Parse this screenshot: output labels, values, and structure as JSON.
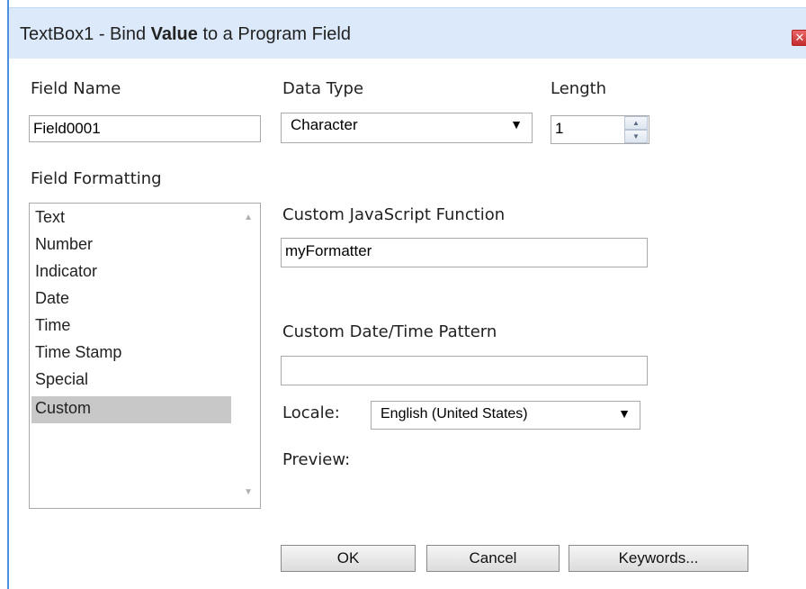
{
  "dialog": {
    "title_prefix": "TextBox1 - Bind ",
    "title_bold": "Value",
    "title_suffix": " to a Program Field",
    "close_glyph": "✕"
  },
  "field_name": {
    "label": "Field Name",
    "value": "Field0001"
  },
  "data_type": {
    "label": "Data Type",
    "value": "Character"
  },
  "length": {
    "label": "Length",
    "value": "1"
  },
  "field_formatting": {
    "label": "Field Formatting",
    "items": [
      "Text",
      "Number",
      "Indicator",
      "Date",
      "Time",
      "Time Stamp",
      "Special",
      "Custom"
    ],
    "selected": "Custom"
  },
  "custom_js": {
    "label": "Custom JavaScript Function",
    "value": "myFormatter"
  },
  "custom_pattern": {
    "label": "Custom Date/Time Pattern",
    "value": ""
  },
  "locale": {
    "label": "Locale:",
    "value": "English (United States)"
  },
  "preview": {
    "label": "Preview:"
  },
  "buttons": {
    "ok": "OK",
    "cancel": "Cancel",
    "keywords": "Keywords..."
  },
  "colors": {
    "titlebar": "#dbe9fa",
    "selected_item": "#c8c8c8",
    "close_button": "#d23b3b"
  }
}
